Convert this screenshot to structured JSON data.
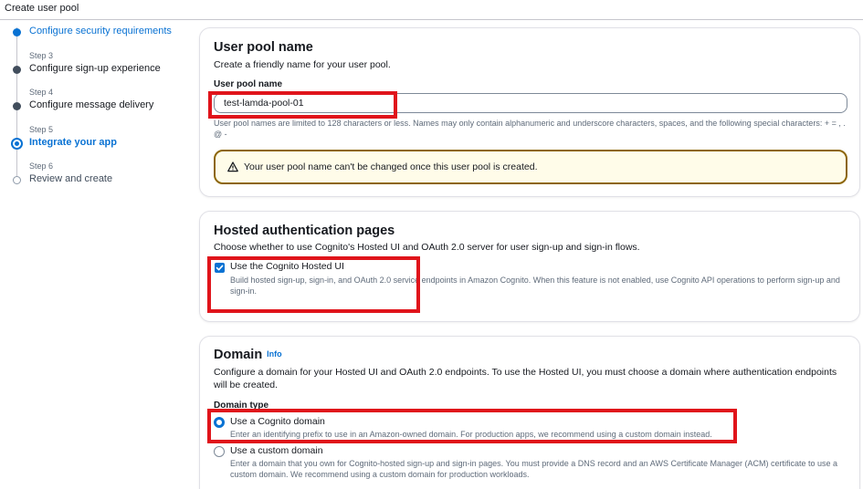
{
  "header": {
    "breadcrumb": "Create user pool"
  },
  "steps": [
    {
      "label": "Configure security requirements",
      "state": "link"
    },
    {
      "num": "Step 3",
      "label": "Configure sign-up experience",
      "state": "done"
    },
    {
      "num": "Step 4",
      "label": "Configure message delivery",
      "state": "done"
    },
    {
      "num": "Step 5",
      "label": "Integrate your app",
      "state": "current"
    },
    {
      "num": "Step 6",
      "label": "Review and create",
      "state": "pending"
    }
  ],
  "pool_name": {
    "title": "User pool name",
    "description": "Create a friendly name for your user pool.",
    "field_label": "User pool name",
    "value": "test-lamda-pool-01",
    "hint": "User pool names are limited to 128 characters or less. Names may only contain alphanumeric and underscore characters, spaces, and the following special characters: + = , . @ -",
    "alert": "Your user pool name can't be changed once this user pool is created."
  },
  "hosted_auth": {
    "title": "Hosted authentication pages",
    "description": "Choose whether to use Cognito's Hosted UI and OAuth 2.0 server for user sign-up and sign-in flows.",
    "checkbox_label": "Use the Cognito Hosted UI",
    "checkbox_checked": true,
    "checkbox_desc": "Build hosted sign-up, sign-in, and OAuth 2.0 service endpoints in Amazon Cognito. When this feature is not enabled, use Cognito API operations to perform sign-up and sign-in."
  },
  "domain": {
    "title": "Domain",
    "info": "Info",
    "description": "Configure a domain for your Hosted UI and OAuth 2.0 endpoints. To use the Hosted UI, you must choose a domain where authentication endpoints will be created.",
    "type_label": "Domain type",
    "selected": "cognito",
    "options": [
      {
        "label": "Use a Cognito domain",
        "desc": "Enter an identifying prefix to use in an Amazon-owned domain. For production apps, we recommend using a custom domain instead."
      },
      {
        "label": "Use a custom domain",
        "desc": "Enter a domain that you own for Cognito-hosted sign-up and sign-in pages. You must provide a DNS record and an AWS Certificate Manager (ACM) certificate to use a custom domain. We recommend using a custom domain for production workloads."
      }
    ]
  },
  "colors": {
    "accent": "#0972d3",
    "highlight": "#e0141b",
    "warning_border": "#8d6605",
    "warning_bg": "#fffce9"
  }
}
